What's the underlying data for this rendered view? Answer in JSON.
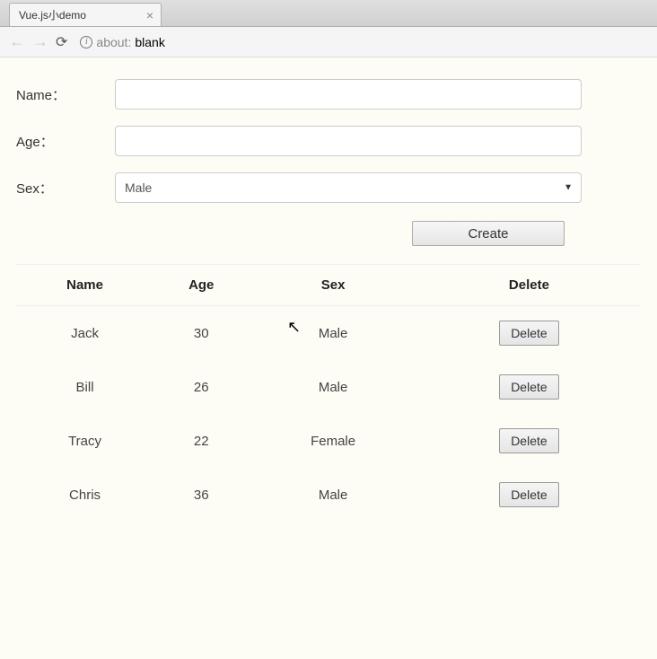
{
  "browser": {
    "tab_title": "Vue.js小demo",
    "url_prefix": "about:",
    "url_path": "blank"
  },
  "form": {
    "name_label": "Name：",
    "age_label": "Age：",
    "sex_label": "Sex：",
    "name_value": "",
    "age_value": "",
    "sex_value": "Male",
    "create_label": "Create"
  },
  "table": {
    "headers": {
      "name": "Name",
      "age": "Age",
      "sex": "Sex",
      "delete": "Delete"
    },
    "delete_label": "Delete",
    "rows": [
      {
        "name": "Jack",
        "age": "30",
        "sex": "Male"
      },
      {
        "name": "Bill",
        "age": "26",
        "sex": "Male"
      },
      {
        "name": "Tracy",
        "age": "22",
        "sex": "Female"
      },
      {
        "name": "Chris",
        "age": "36",
        "sex": "Male"
      }
    ]
  }
}
